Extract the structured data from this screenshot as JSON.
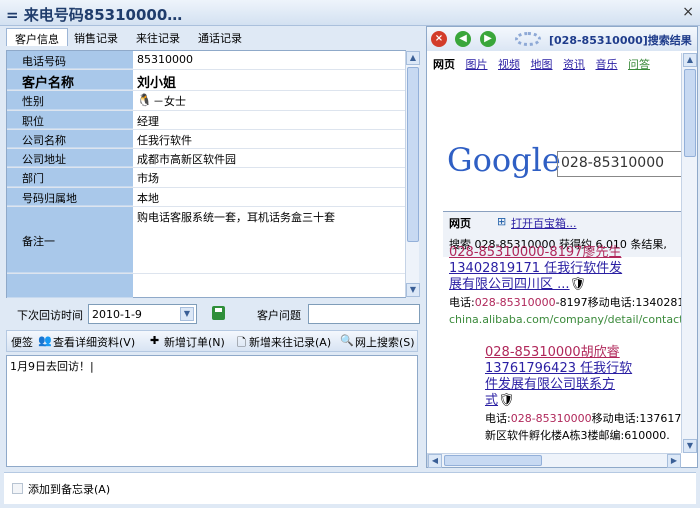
{
  "window": {
    "title": "= 来电号码85310000…",
    "close": "×"
  },
  "tabs": [
    "客户信息",
    "销售记录",
    "来往记录",
    "通话记录"
  ],
  "fields": [
    {
      "label": "电话号码",
      "value": "85310000"
    },
    {
      "label": "客户名称",
      "value": "刘小姐"
    },
    {
      "label": "性别",
      "value": "－女士"
    },
    {
      "label": "职位",
      "value": "经理"
    },
    {
      "label": "公司名称",
      "value": "任我行软件"
    },
    {
      "label": "公司地址",
      "value": "成都市高新区软件园"
    },
    {
      "label": "部门",
      "value": "市场"
    },
    {
      "label": "号码归属地",
      "value": "本地"
    },
    {
      "label": "备注一",
      "value": "购电话客服系统一套，耳机话务盒三十套"
    }
  ],
  "visit": {
    "label": "下次回访时间",
    "date": "2010-1-9",
    "issue_label": "客户问题",
    "issue_value": ""
  },
  "toolbar": {
    "memo": "便签",
    "view": "查看详细资料(V)",
    "order": "新增订单(N)",
    "record": "新增来往记录(A)",
    "search": "网上搜索(S)"
  },
  "memo_text": "1月9日去回访！",
  "add_memo": "添加到备忘录(A)",
  "browser": {
    "title": "[028-85310000]搜索结果",
    "nav": [
      "网页",
      "图片",
      "视频",
      "地图",
      "资讯",
      "音乐",
      "问答"
    ],
    "logo": "Google",
    "query": "028-85310000",
    "section": "网页",
    "toolbox": "打开百宝箱...",
    "stats": "搜索 028-85310000 获得约 6,010 条结果,",
    "results": [
      {
        "title1": "028-85310000-8197廖先生",
        "title2": "13402819171 任我行软件发",
        "title3": "展有限公司四川区 ...",
        "snippet_pre": "电话:",
        "snippet_hl": "028-85310000",
        "snippet_post": "-8197移动电话:1340281",
        "url": "china.alibaba.com/company/detail/contact/"
      },
      {
        "title1": "028-85310000胡欣睿",
        "title2": "13761796423 任我行软",
        "title3": "件发展有限公司联系方",
        "title4": "式",
        "snippet_pre": "电话:",
        "snippet_hl": "028-85310000",
        "snippet_post": "移动电话:137617",
        "snippet2": "新区软件孵化楼A栋3楼邮编:610000."
      }
    ]
  }
}
